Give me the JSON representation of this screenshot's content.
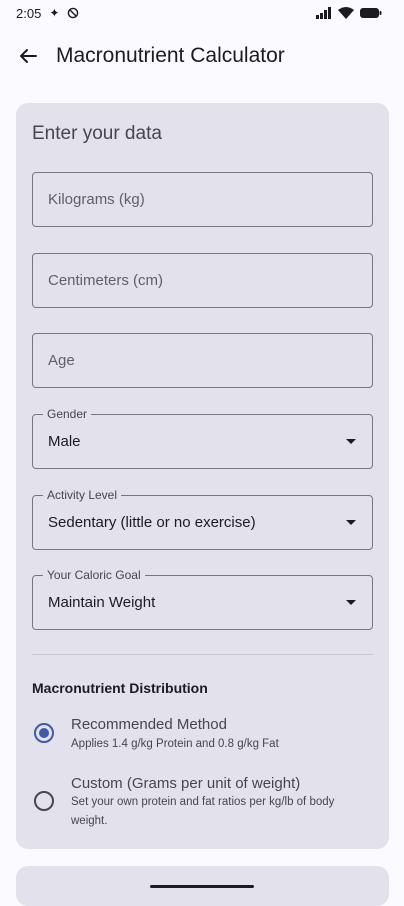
{
  "status_bar": {
    "time": "2:05"
  },
  "app_bar": {
    "title": "Macronutrient Calculator"
  },
  "form": {
    "heading": "Enter your data",
    "weight_placeholder": "Kilograms (kg)",
    "height_placeholder": "Centimeters (cm)",
    "age_placeholder": "Age",
    "gender": {
      "label": "Gender",
      "value": "Male"
    },
    "activity": {
      "label": "Activity Level",
      "value": "Sedentary (little or no exercise)"
    },
    "goal": {
      "label": "Your Caloric Goal",
      "value": "Maintain Weight"
    }
  },
  "distribution": {
    "title": "Macronutrient Distribution",
    "options": [
      {
        "title": "Recommended Method",
        "subtitle": "Applies 1.4 g/kg Protein and 0.8 g/kg Fat",
        "selected": true
      },
      {
        "title": "Custom (Grams per unit of weight)",
        "subtitle": "Set your own protein and fat ratios per kg/lb of body weight.",
        "selected": false
      }
    ]
  },
  "colors": {
    "accent": "#3f5aa9",
    "card": "#e3e2ec",
    "background": "#fafaff"
  }
}
